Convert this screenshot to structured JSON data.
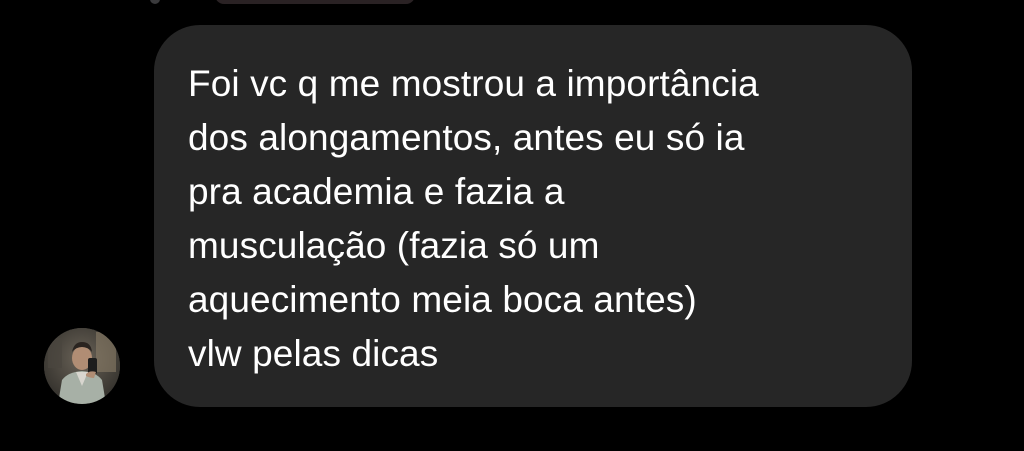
{
  "conversation": {
    "incoming_message": {
      "text": "Foi vc q me mostrou a importância\ndos alongamentos, antes eu só ia\npra academia e fazia a\nmusculação (fazia só um\naquecimento meia boca antes)\nvlw pelas dicas"
    },
    "sender_avatar": {
      "icon": "profile-photo"
    }
  },
  "colors": {
    "background": "#000000",
    "bubble": "#262626",
    "text": "#ffffff"
  }
}
